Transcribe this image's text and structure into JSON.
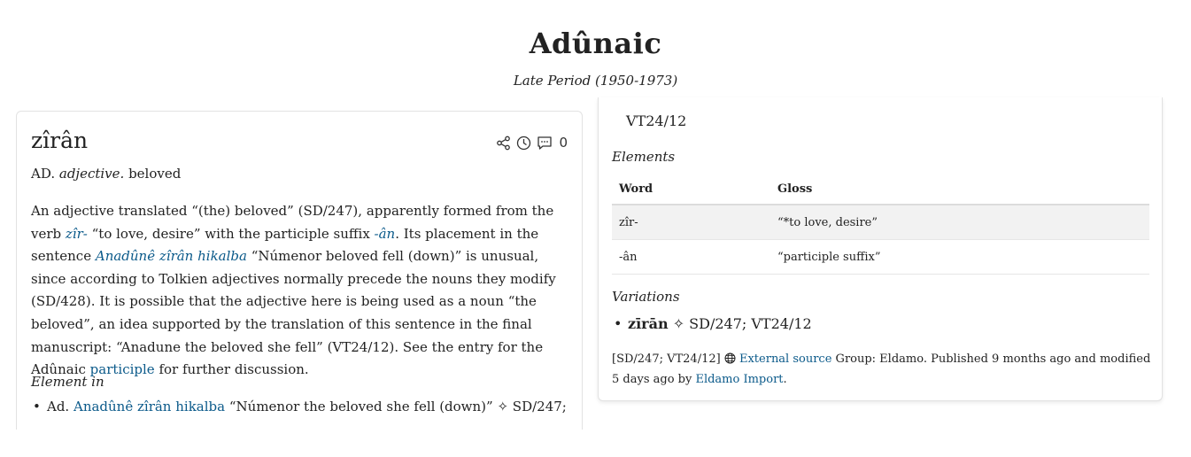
{
  "header": {
    "title": "Adûnaic",
    "subtitle": "Late Period (1950-1973)"
  },
  "entry": {
    "word": "zîrân",
    "comment_count": "0",
    "language_abbr": "AD.",
    "part_of_speech": "adjective.",
    "gloss": "beloved",
    "definition": {
      "t1": "An adjective translated “(the) beloved” (SD/247), apparently formed from the verb ",
      "link_verb": "zîr-",
      "t2": " “to love, desire” with the participle suffix ",
      "link_suffix": "-ân",
      "t3": ". Its placement in the sentence ",
      "link_sentence": "Anadûnê zîrân hikalba",
      "t4": " “Númenor beloved fell (down)” is unusual, since according to Tolkien adjectives normally precede the nouns they modify (SD/428). It is possible that the adjective here is being used as a noun “the beloved”, an idea supported by the translation of this sentence in the final manuscript: “Anadune the beloved she fell” (VT24/12). See the entry for the Adûnaic ",
      "link_participle": "participle",
      "t5": " for further discussion."
    },
    "element_in": {
      "label": "Element in",
      "items": [
        {
          "prefix": "Ad.",
          "link": "Anadûnê zîrân hikalba",
          "rest": "“Númenor the beloved she fell (down)” ✧ SD/247;"
        }
      ]
    }
  },
  "details": {
    "reference_top": "VT24/12",
    "elements_label": "Elements",
    "table": {
      "headers": [
        "Word",
        "Gloss"
      ],
      "rows": [
        [
          "zîr-",
          "“*to love, desire”"
        ],
        [
          "-ân",
          "“participle suffix”"
        ]
      ]
    },
    "variations_label": "Variations",
    "variations": [
      {
        "form": "zīrān",
        "refs": "✧ SD/247; VT24/12"
      }
    ],
    "footer": {
      "refs": "[SD/247; VT24/12]",
      "external_link": "External source",
      "group_text": " Group: Eldamo. Published 9 months ago and modified 5 days ago by ",
      "author_link": "Eldamo Import",
      "end": "."
    }
  }
}
